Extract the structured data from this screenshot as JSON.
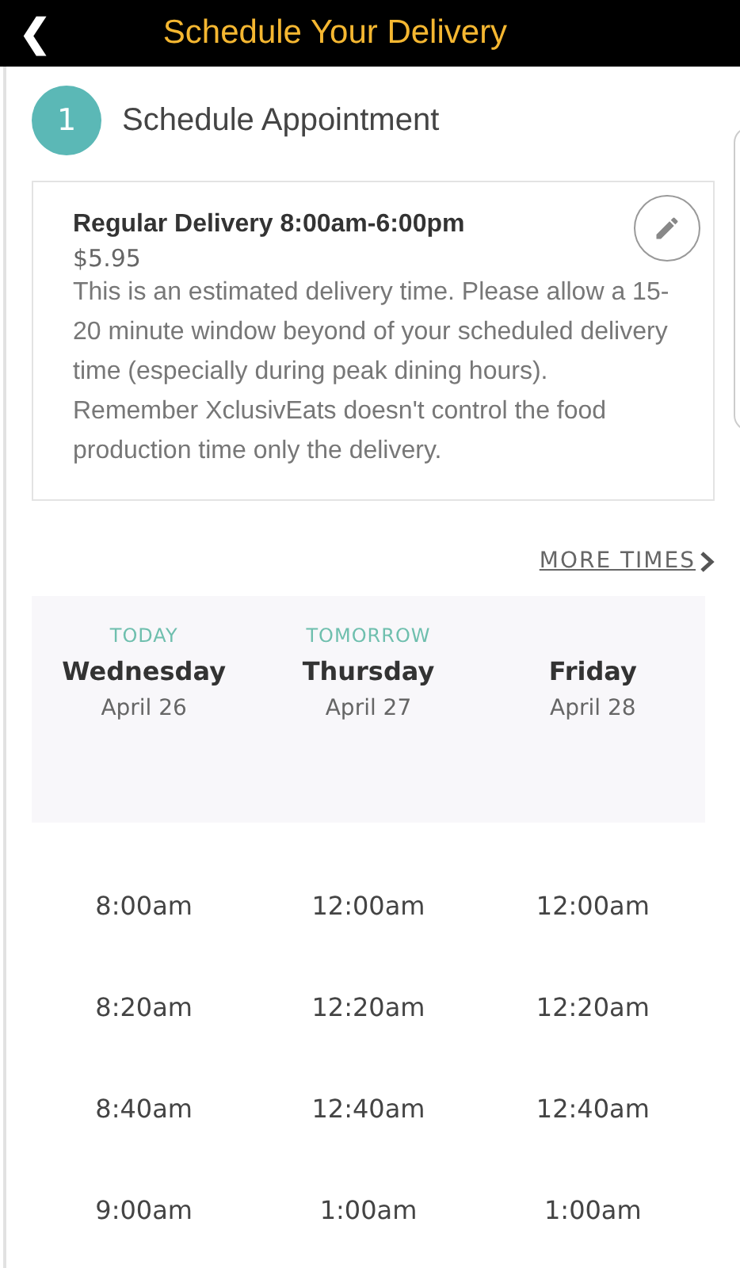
{
  "header": {
    "back": "❮",
    "title": "Schedule Your Delivery"
  },
  "step": {
    "number": "1",
    "title": "Schedule Appointment"
  },
  "option": {
    "title": "Regular Delivery 8:00am-6:00pm",
    "price": "$5.95",
    "description": "This is an estimated delivery time. Please allow a 15-20 minute window beyond of your scheduled delivery time (especially during peak dining hours). Remember XclusivEats doesn't control the food production time only the delivery."
  },
  "more_times": "MORE TIMES",
  "days": [
    {
      "tag": "TODAY",
      "weekday": "Wednesday",
      "date": "April 26",
      "times": [
        "8:00am",
        "8:20am",
        "8:40am",
        "9:00am"
      ]
    },
    {
      "tag": "TOMORROW",
      "weekday": "Thursday",
      "date": "April 27",
      "times": [
        "12:00am",
        "12:20am",
        "12:40am",
        "1:00am"
      ]
    },
    {
      "weekday": "Friday",
      "date": "April 28",
      "times": [
        "12:00am",
        "12:20am",
        "12:40am",
        "1:00am"
      ]
    }
  ]
}
